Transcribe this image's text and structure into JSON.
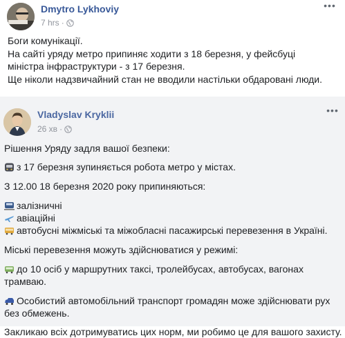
{
  "post1": {
    "author": "Dmytro Lykhoviy",
    "time": "7 hrs",
    "separator": "·",
    "privacy_icon": "globe-icon",
    "more_icon": "more-options-icon",
    "lines": [
      "Боги комунікації.",
      "На сайті уряду метро припиняє ходити з 18 березня, у фейсбуці",
      "міністра інфраструктури - з 17 березня.",
      "Ще ніколи надзвичайний стан не вводили настільки обдаровані люди."
    ]
  },
  "post2": {
    "author": "Vladyslav Kryklii",
    "time": "26 хв",
    "separator": "·",
    "privacy_icon": "globe-icon",
    "more_icon": "more-options-icon",
    "lines": {
      "l1": "Рішення Уряду задля вашої безпеки:",
      "l2": "з 17 березня зупиняється робота метро у містах.",
      "l3": "З 12.00 18 березня 2020 року припиняються:",
      "l4": "залізничні",
      "l5": "авіаційні",
      "l6": "автобусні міжміські та міжобласні пасажирські перевезення в Україні.",
      "l7": "Міські перевезення можуть здійснюватися у режимі:",
      "l8a": "до 10 осіб у маршрутних таксі, тролейбусах, автобусах, вагонах",
      "l8b": "трамваю.",
      "l9a": "Особистий автомобільний транспорт громадян може здійснювати рух",
      "l9b": "без обмежень.",
      "l10": "Закликаю всіх дотримуватись цих норм, ми робимо це для вашого захисту."
    },
    "emoji_icons": [
      "metro-icon",
      "train-icon",
      "airplane-icon",
      "bus-icon",
      "minibus-icon",
      "car-icon"
    ]
  }
}
